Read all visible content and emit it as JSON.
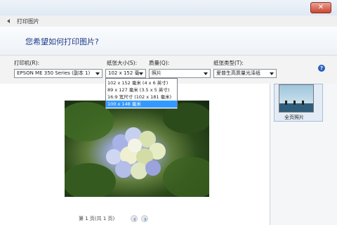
{
  "window": {
    "close_label": "✕"
  },
  "breadcrumb": {
    "title": "打印图片"
  },
  "heading": "您希望如何打印图片?",
  "fields": {
    "printer": {
      "label": "打印机(R):",
      "value": "EPSON ME 350 Series (副本 1)"
    },
    "paper_size": {
      "label": "纸张大小(S):",
      "value": "102 x 152 毫"
    },
    "quality": {
      "label": "质量(Q):",
      "value": "照片"
    },
    "paper_type": {
      "label": "纸张类型(T):",
      "value": "爱普生高质量光泽纸"
    }
  },
  "paper_size_options": [
    "102 x 152 毫米 (4 x 6 英寸)",
    "89 x 127 毫米 (3.5 x 5 英寸)",
    "16:9 宽尺寸 (102 x 181 毫米)",
    "100 x 148 毫米"
  ],
  "selected_option_index": 3,
  "layout": {
    "caption": "全页照片"
  },
  "page_nav": {
    "label": "第 1 页(共 1 页)"
  },
  "help_icon": "?",
  "icons": {
    "back": "back-arrow-icon",
    "help": "help-icon",
    "prev": "prev-page-icon",
    "next": "next-page-icon"
  },
  "colors": {
    "accent": "#3399ff",
    "heading": "#1f3a8a",
    "close": "#c9462f"
  }
}
